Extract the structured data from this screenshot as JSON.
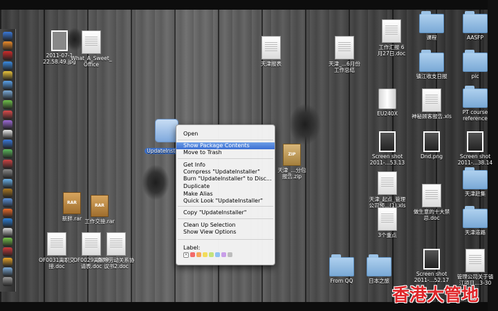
{
  "desktop_icons": [
    {
      "id": "photo_jpg",
      "label": "2011-07-1\n22.58.49.jpg",
      "type": "image"
    },
    {
      "id": "what_a_sweet",
      "label": "What_A_Sweet_\nOffice",
      "type": "doc"
    },
    {
      "id": "xlsx1",
      "label": "天津报表",
      "type": "doc"
    },
    {
      "id": "doc_work_report",
      "label": "天津_...6月份\n工作总结",
      "type": "doc"
    },
    {
      "id": "doc_627",
      "label": "工作汇报 6\n月27日.doc",
      "type": "doc"
    },
    {
      "id": "folder_courses",
      "label": "课程",
      "type": "folder"
    },
    {
      "id": "folder_aasfp",
      "label": "AASFP",
      "type": "folder"
    },
    {
      "id": "folder_zhenjiang",
      "label": "镇江收支日报",
      "type": "folder"
    },
    {
      "id": "folder_pic",
      "label": "pic",
      "type": "folder"
    },
    {
      "id": "drive_eu240x",
      "label": "EU240X",
      "type": "drive"
    },
    {
      "id": "xls_report",
      "label": "神秘顾客报告.xls",
      "type": "doc"
    },
    {
      "id": "folder_pt_course",
      "label": "PT course\nreference",
      "type": "folder"
    },
    {
      "id": "update_installer",
      "label": "UpdateInstaller",
      "type": "app"
    },
    {
      "id": "zip1",
      "label": "天津_...分包\n报告.zip",
      "type": "zip"
    },
    {
      "id": "screenshot1",
      "label": "Screen shot\n2011-...53.13",
      "type": "image"
    },
    {
      "id": "dnd_png",
      "label": "Dnd.png",
      "type": "image"
    },
    {
      "id": "screenshot2",
      "label": "Screen shot\n2011-...38.14",
      "type": "image"
    },
    {
      "id": "folder_tianjin_1",
      "label": "天津赶集",
      "type": "folder"
    },
    {
      "id": "xls_manage",
      "label": "天津_起点_管理\n公司预...(1).xls",
      "type": "doc"
    },
    {
      "id": "doc_ten",
      "label": "做生意的十大禁\n忌.doc",
      "type": "doc"
    },
    {
      "id": "folder_tianjin_2",
      "label": "天津道路",
      "type": "folder"
    },
    {
      "id": "rar_new",
      "label": "新胖.rar",
      "type": "rar"
    },
    {
      "id": "rar_work",
      "label": "工作交接.rar",
      "type": "rar"
    },
    {
      "id": "doc_three",
      "label": "3个重点",
      "type": "doc"
    },
    {
      "id": "doc_of0031",
      "label": "OF0031离职交\n接.doc",
      "type": "doc"
    },
    {
      "id": "doc_of0029",
      "label": "OF0029离职申\n请表.doc",
      "type": "doc"
    },
    {
      "id": "doc_contract",
      "label": "解除劳动关系协\n议书2.doc",
      "type": "doc"
    },
    {
      "id": "folder_from_qq",
      "label": "From QQ",
      "type": "folder"
    },
    {
      "id": "folder_japan",
      "label": "日本之旅",
      "type": "folder"
    },
    {
      "id": "screenshot3",
      "label": "Screen shot\n2011-...52.17",
      "type": "image"
    },
    {
      "id": "doc_manage_company",
      "label": "管理公司关于镇\n江项目...3-30",
      "type": "doc"
    }
  ],
  "context_menu": {
    "items": [
      "Open",
      "Show Package Contents",
      "Move to Trash",
      "Get Info",
      "Compress \"UpdateInstaller\"",
      "Burn \"UpdateInstaller\" to Disc...",
      "Duplicate",
      "Make Alias",
      "Quick Look \"UpdateInstaller\"",
      "Copy \"UpdateInstaller\"",
      "Clean Up Selection",
      "Show View Options"
    ],
    "highlighted_index": 1,
    "label_heading": "Label:",
    "label_none_glyph": "×",
    "label_colors": [
      "#f26b6b",
      "#f5a85c",
      "#f2dc5b",
      "#c4e27a",
      "#8fc1f2",
      "#c89ee8",
      "#bdbdbd"
    ]
  },
  "dock_colors": [
    "#3a78d8",
    "#e98a2a",
    "#cc2b2b",
    "#3b8be0",
    "#e8c23a",
    "#5aa0e8",
    "#7aa9d6",
    "#6fbf4a",
    "#d84b4b",
    "#9d6ad6",
    "#e8e8e8",
    "#3a78d8",
    "#5cb85c",
    "#c44",
    "#888",
    "#6ab0e8",
    "#aa7722",
    "#5a90d8",
    "#e86a2a",
    "#2c7fd8",
    "#d8d8d8",
    "#76c24a",
    "#cc3b3b",
    "#e8a42a",
    "#7aa9d6",
    "#9a9a9a"
  ],
  "watermark": "香港大管地"
}
